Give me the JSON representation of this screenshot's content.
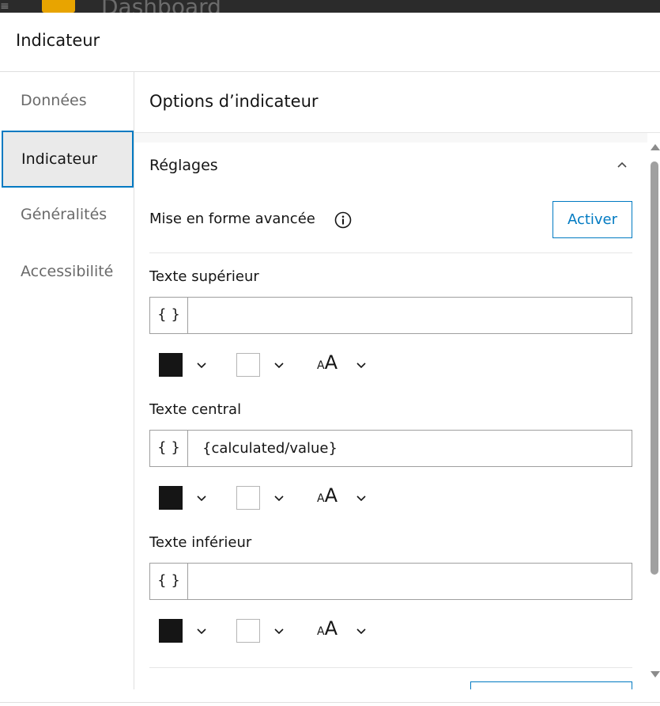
{
  "background": {
    "title": "Dashboard"
  },
  "modal": {
    "title": "Indicateur"
  },
  "sidebar": {
    "items": [
      {
        "label": "Données",
        "active": false
      },
      {
        "label": "Indicateur",
        "active": true
      },
      {
        "label": "Généralités",
        "active": false
      },
      {
        "label": "Accessibilité",
        "active": false
      }
    ]
  },
  "panel": {
    "title": "Options d’indicateur",
    "section": {
      "title": "Réglages",
      "advanced_label": "Mise en forme avancée",
      "activate_label": "Activer",
      "fields": [
        {
          "label": "Texte supérieur",
          "prefix": "{ }",
          "value": "",
          "text_color": "#151515",
          "background_color": "none",
          "size_icon": "aA"
        },
        {
          "label": "Texte central",
          "prefix": "{ }",
          "value": "{calculated/value}",
          "text_color": "#151515",
          "background_color": "none",
          "size_icon": "aA"
        },
        {
          "label": "Texte inférieur",
          "prefix": "{ }",
          "value": "",
          "text_color": "#151515",
          "background_color": "none",
          "size_icon": "aA"
        }
      ]
    }
  },
  "colors": {
    "accent": "#007ac2",
    "active_bg": "#eaeaea",
    "text": "#151515",
    "muted_text": "#6a6a6a"
  }
}
